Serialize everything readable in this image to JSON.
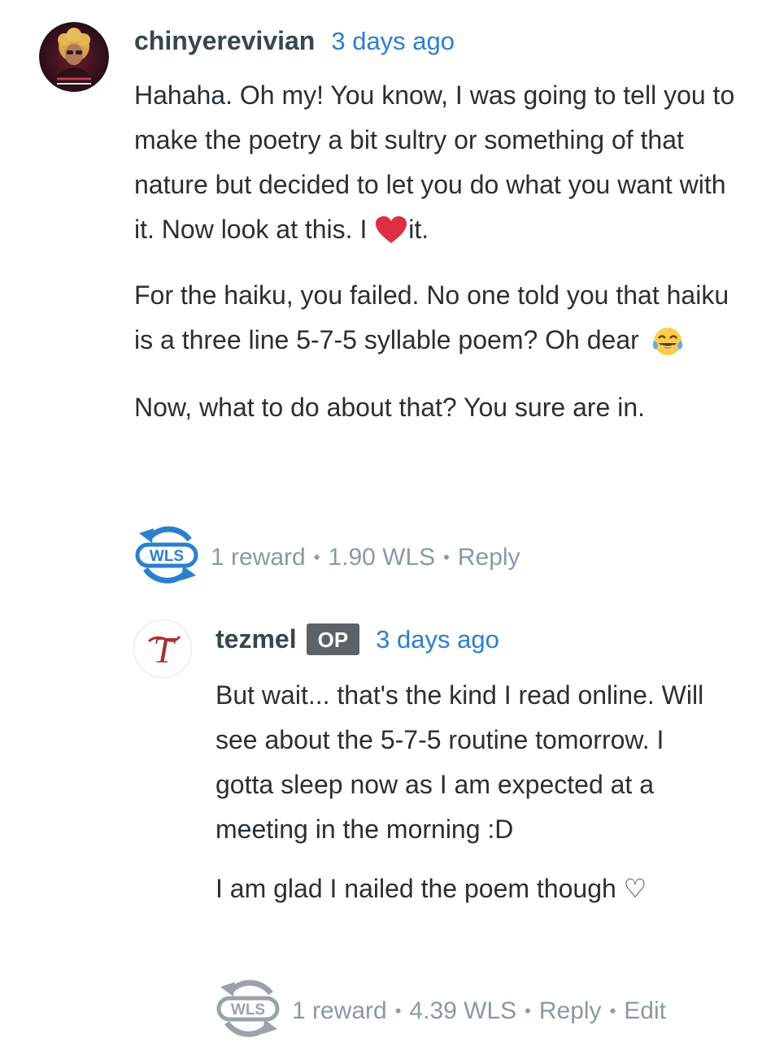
{
  "comments": [
    {
      "author": "chinyerevivian",
      "time": "3 days ago",
      "paragraphs": {
        "p1_a": "Hahaha. Oh my! You know, I was going to tell you to make the poetry a bit sultry or something of that nature but decided to let you do what you want with it. Now look at this. I ",
        "p1_b": "it.",
        "p2": "For the haiku, you failed. No one told you that haiku is a three line 5-7-5 syllable poem? Oh dear ",
        "p3": "Now, what to do about that? You sure are in."
      },
      "wls_badge": "WLS",
      "rewards": "1 reward",
      "amount": "1.90 WLS",
      "reply": "Reply",
      "separator": "•"
    },
    {
      "author": "tezmel",
      "op_badge": "OP",
      "time": "3 days ago",
      "paragraphs": {
        "p1": "But wait... that's the kind I read online. Will see about the 5-7-5 routine tomorrow. I gotta sleep now as I am expected at a meeting in the morning :D",
        "p2": "I am glad I nailed the poem though ♡"
      },
      "wls_badge": "WLS",
      "rewards": "1 reward",
      "amount": "4.39 WLS",
      "reply": "Reply",
      "edit": "Edit",
      "separator": "•"
    }
  ],
  "colors": {
    "author": "#37474f",
    "timestamp": "#2b7fce",
    "footer": "#8b98a5",
    "wls_blue": "#2b7fce",
    "wls_gray": "#9aa3ab",
    "op_badge_bg": "#5b6268"
  },
  "icons": {
    "heart": "red-heart-icon",
    "laugh": "tears-of-joy-emoji-icon",
    "wls": "wls-reward-icon"
  }
}
